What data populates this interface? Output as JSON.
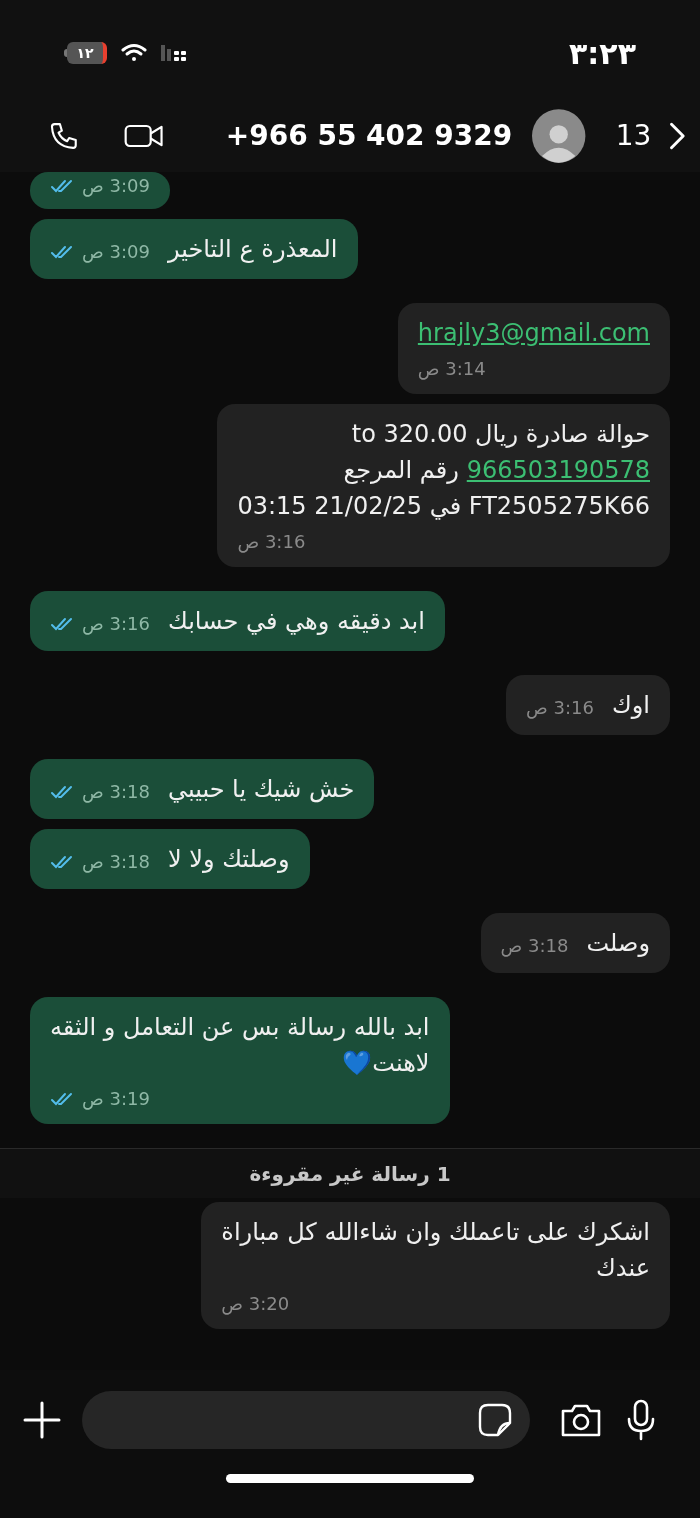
{
  "status_bar": {
    "time": "٣:٢٣",
    "battery": "١٢"
  },
  "header": {
    "contact": "+966 55 402 9329",
    "back_count": "13"
  },
  "messages": [
    {
      "kind": "sent",
      "time": "3:09 ص",
      "read": true
    },
    {
      "kind": "sent",
      "lines": [
        {
          "text": "المعذرة ع التاخير"
        }
      ],
      "time": "3:09 ص",
      "read": true
    },
    {
      "kind": "received",
      "lines": [
        {
          "link": "hrajly3@gmail.com"
        }
      ],
      "time": "3:14 ص"
    },
    {
      "kind": "received",
      "lines": [
        {
          "text": "حوالة صادرة ريال 320.00 to"
        },
        {
          "link": "966503190578",
          "text": "رقم المرجع"
        },
        {
          "text": "FT2505275K66 في 21/02/25 03:15"
        }
      ],
      "time": "3:16 ص"
    },
    {
      "kind": "sent",
      "lines": [
        {
          "text": "ابد دقيقه وهي في حسابك"
        }
      ],
      "time": "3:16 ص",
      "read": true
    },
    {
      "kind": "received",
      "lines": [
        {
          "text": "اوك"
        }
      ],
      "time": "3:16 ص"
    },
    {
      "kind": "sent",
      "lines": [
        {
          "text": "خش شيك يا حبيبي"
        }
      ],
      "time": "3:18 ص",
      "read": true
    },
    {
      "kind": "sent",
      "lines": [
        {
          "text": "وصلتك ولا لا"
        }
      ],
      "time": "3:18 ص",
      "read": true
    },
    {
      "kind": "received",
      "lines": [
        {
          "text": "وصلت"
        }
      ],
      "time": "3:18 ص"
    },
    {
      "kind": "sent",
      "lines": [
        {
          "text": "ابد بالله رسالة بس عن التعامل و الثقه"
        },
        {
          "text": "لاهنت💙"
        }
      ],
      "time": "3:19 ص",
      "read": true
    },
    {
      "kind": "divider",
      "text": "1 رسالة غير مقروءة"
    },
    {
      "kind": "received",
      "lines": [
        {
          "text": "اشكرك على تاعملك وان شاءالله كل مباراة"
        },
        {
          "text": "عندك"
        }
      ],
      "time": "3:20 ص"
    }
  ]
}
